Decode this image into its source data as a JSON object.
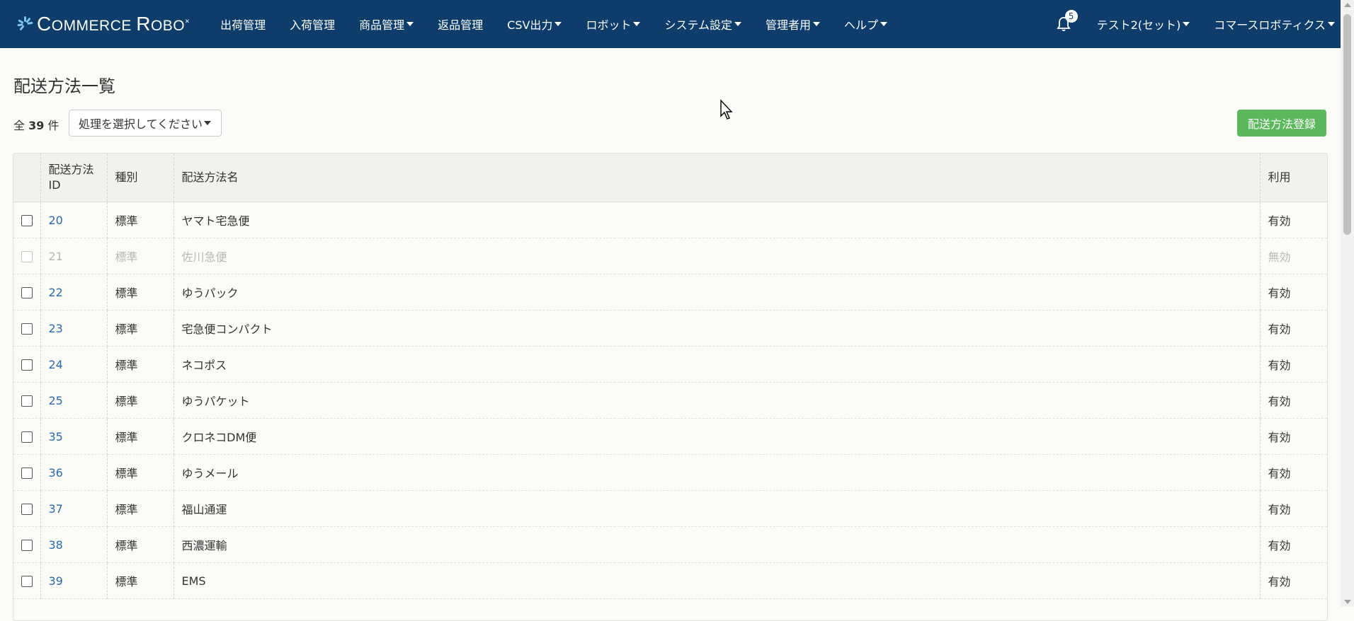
{
  "brand": {
    "name_big_c": "C",
    "name_small_1": "OMMERCE ",
    "name_big_r": "R",
    "name_small_2": "OBO",
    "mark": "×"
  },
  "nav": {
    "items": [
      {
        "label": "出荷管理",
        "dropdown": false
      },
      {
        "label": "入荷管理",
        "dropdown": false
      },
      {
        "label": "商品管理",
        "dropdown": true
      },
      {
        "label": "返品管理",
        "dropdown": false
      },
      {
        "label": "CSV出力",
        "dropdown": true
      },
      {
        "label": "ロボット",
        "dropdown": true
      },
      {
        "label": "システム設定",
        "dropdown": true
      },
      {
        "label": "管理者用",
        "dropdown": true
      },
      {
        "label": "ヘルプ",
        "dropdown": true
      }
    ],
    "notification_count": "5",
    "user": "テスト2(セット)",
    "company": "コマースロボティクス"
  },
  "page": {
    "title": "配送方法一覧",
    "count_prefix": "全",
    "count": "39",
    "count_suffix": "件",
    "action_select": "処理を選択してください",
    "register_button": "配送方法登録"
  },
  "table": {
    "headers": {
      "id_line1": "配送方法",
      "id_line2": "ID",
      "type": "種別",
      "name": "配送方法名",
      "status": "利用"
    },
    "rows": [
      {
        "id": "20",
        "type": "標準",
        "name": "ヤマト宅急便",
        "status": "有効",
        "disabled": false
      },
      {
        "id": "21",
        "type": "標準",
        "name": "佐川急便",
        "status": "無効",
        "disabled": true
      },
      {
        "id": "22",
        "type": "標準",
        "name": "ゆうパック",
        "status": "有効",
        "disabled": false
      },
      {
        "id": "23",
        "type": "標準",
        "name": "宅急便コンパクト",
        "status": "有効",
        "disabled": false
      },
      {
        "id": "24",
        "type": "標準",
        "name": "ネコポス",
        "status": "有効",
        "disabled": false
      },
      {
        "id": "25",
        "type": "標準",
        "name": "ゆうパケット",
        "status": "有効",
        "disabled": false
      },
      {
        "id": "35",
        "type": "標準",
        "name": "クロネコDM便",
        "status": "有効",
        "disabled": false
      },
      {
        "id": "36",
        "type": "標準",
        "name": "ゆうメール",
        "status": "有効",
        "disabled": false
      },
      {
        "id": "37",
        "type": "標準",
        "name": "福山通運",
        "status": "有効",
        "disabled": false
      },
      {
        "id": "38",
        "type": "標準",
        "name": "西濃運輸",
        "status": "有効",
        "disabled": false
      },
      {
        "id": "39",
        "type": "標準",
        "name": "EMS",
        "status": "有効",
        "disabled": false
      }
    ]
  },
  "colors": {
    "navbar": "#0e3d6b",
    "link": "#2a6ab0",
    "success": "#5cb85c"
  }
}
